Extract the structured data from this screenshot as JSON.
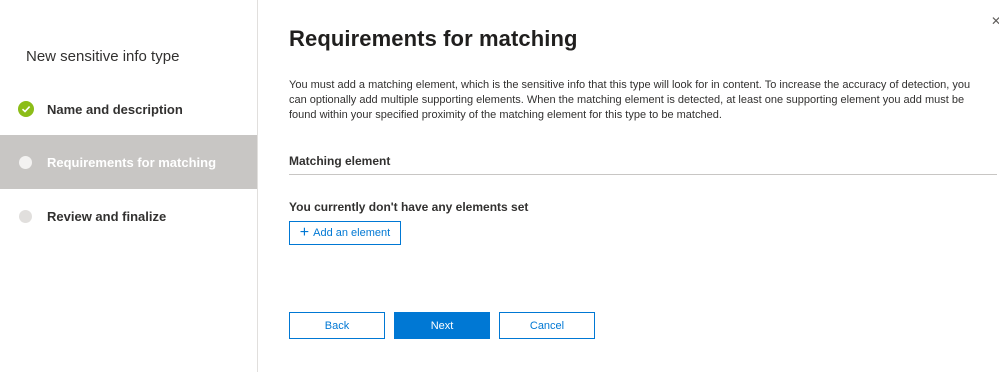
{
  "wizard": {
    "title": "New sensitive info type",
    "steps": [
      {
        "label": "Name and description",
        "status": "complete",
        "color": "#8cbd18"
      },
      {
        "label": "Requirements for matching",
        "status": "current"
      },
      {
        "label": "Review and finalize",
        "status": "pending"
      }
    ]
  },
  "main": {
    "title": "Requirements for matching",
    "close_icon": "close-icon",
    "description": "You must add a matching element, which is the sensitive info that this type will look for in content. To increase the accuracy of detection, you can optionally add multiple supporting elements. When the matching element is detected, at least one supporting element you add must be found within your specified proximity of the matching element for this type to be matched.",
    "section_header": "Matching element",
    "empty_text": "You currently don't have any elements set",
    "add_button_label": "Add an element",
    "add_button_icon": "plus-icon"
  },
  "footer": {
    "back_label": "Back",
    "next_label": "Next",
    "cancel_label": "Cancel"
  },
  "colors": {
    "accent": "#0078d4",
    "complete": "#8cbd18",
    "selected_step_bg": "#c8c6c4"
  }
}
